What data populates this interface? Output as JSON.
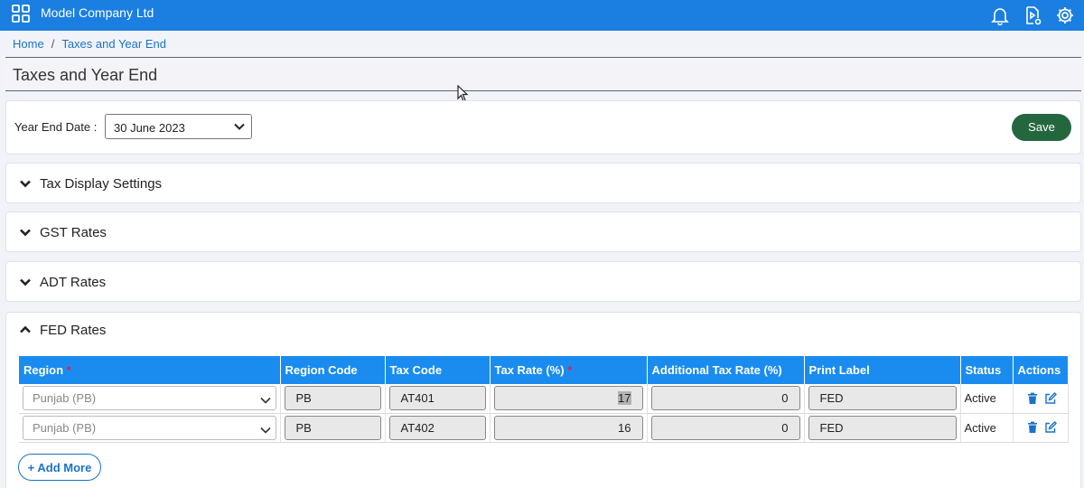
{
  "app": {
    "company_name": "Model Company Ltd",
    "icons": [
      "grid-icon",
      "bell-icon",
      "video-help-icon",
      "gear-icon"
    ]
  },
  "breadcrumb": {
    "home": "Home",
    "separator": "/",
    "current": "Taxes and Year End"
  },
  "page": {
    "title": "Taxes and Year End"
  },
  "year_end": {
    "label": "Year End Date :",
    "value": "30 June 2023",
    "save_label": "Save"
  },
  "sections": {
    "tax_display": "Tax Display Settings",
    "gst": "GST Rates",
    "adt": "ADT Rates",
    "fed": "FED Rates"
  },
  "fed_table": {
    "headers": {
      "region": "Region",
      "region_required": "*",
      "region_code": "Region Code",
      "tax_code": "Tax Code",
      "tax_rate": "Tax Rate (%)",
      "tax_rate_required": "*",
      "additional_tax_rate": "Additional Tax Rate (%)",
      "print_label": "Print Label",
      "status": "Status",
      "actions": "Actions"
    },
    "rows": [
      {
        "region": "Punjab (PB)",
        "region_code": "PB",
        "tax_code": "AT401",
        "tax_rate": "17",
        "additional_tax_rate": "0",
        "print_label": "FED",
        "status": "Active"
      },
      {
        "region": "Punjab (PB)",
        "region_code": "PB",
        "tax_code": "AT402",
        "tax_rate": "16",
        "additional_tax_rate": "0",
        "print_label": "FED",
        "status": "Active"
      }
    ],
    "add_more_label": "+ Add More"
  },
  "colors": {
    "topbar": "#1a7fe0",
    "table_header": "#1a8cf0",
    "save_button": "#24673f",
    "link": "#1a73c8",
    "required": "#e0204a"
  }
}
